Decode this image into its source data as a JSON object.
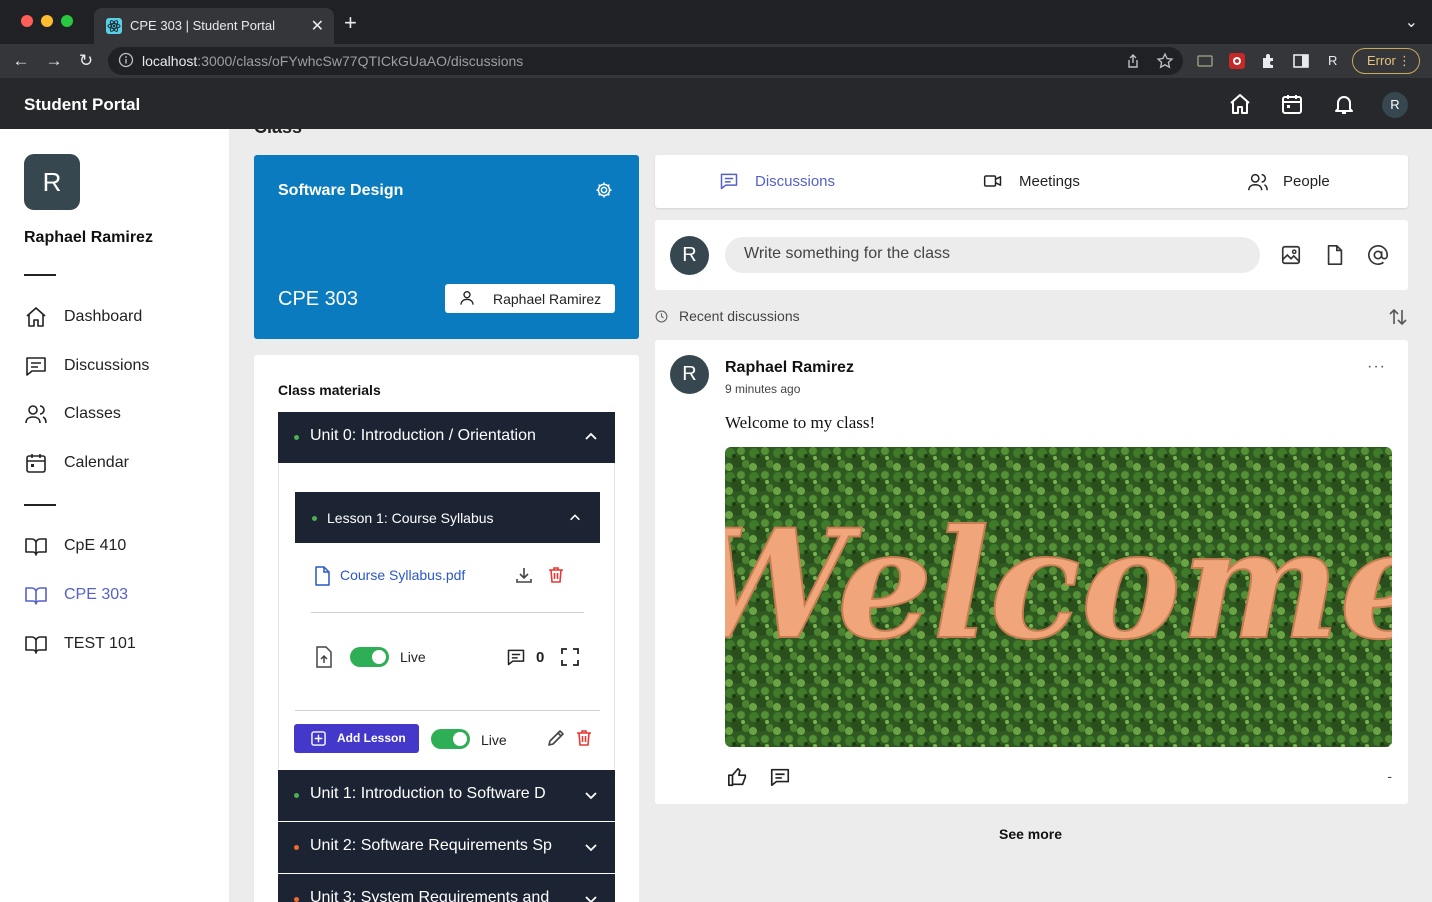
{
  "browser": {
    "tab_title": "CPE 303 | Student Portal",
    "url_host": "localhost",
    "url_path": ":3000/class/oFYwhcSw77QTICkGUaAO/discussions",
    "profile_initial": "R",
    "error_label": "Error"
  },
  "header": {
    "brand": "Student Portal",
    "avatar_initial": "R"
  },
  "sidebar": {
    "avatar_initial": "R",
    "user_name": "Raphael Ramirez",
    "nav": [
      {
        "label": "Dashboard",
        "icon": "home-icon"
      },
      {
        "label": "Discussions",
        "icon": "chat-icon"
      },
      {
        "label": "Classes",
        "icon": "people-icon"
      },
      {
        "label": "Calendar",
        "icon": "calendar-icon"
      }
    ],
    "classes": [
      {
        "label": "CpE 410",
        "active": false
      },
      {
        "label": "CPE 303",
        "active": true
      },
      {
        "label": "TEST 101",
        "active": false
      }
    ]
  },
  "class": {
    "section_title": "Class",
    "name": "Software Design",
    "code": "CPE 303",
    "teacher": "Raphael Ramirez"
  },
  "materials": {
    "title": "Class materials",
    "units": [
      {
        "label": "Unit 0: Introduction / Orientation",
        "status_color": "#4caf50",
        "expanded": true
      },
      {
        "label": "Unit 1: Introduction to Software D",
        "status_color": "#4caf50",
        "expanded": false
      },
      {
        "label": "Unit 2: Software Requirements Sp",
        "status_color": "#f26b2f",
        "expanded": false
      },
      {
        "label": "Unit 3: System Requirements and",
        "status_color": "#f26b2f",
        "expanded": false
      }
    ],
    "lesson": {
      "label": "Lesson 1: Course Syllabus",
      "file": "Course Syllabus.pdf",
      "live_label": "Live",
      "comment_count": "0"
    },
    "add_lesson_label": "Add Lesson",
    "unit_live_label": "Live"
  },
  "tabs": [
    {
      "label": "Discussions",
      "active": true
    },
    {
      "label": "Meetings",
      "active": false
    },
    {
      "label": "People",
      "active": false
    }
  ],
  "composer": {
    "avatar_initial": "R",
    "placeholder": "Write something for the class"
  },
  "feed": {
    "recent_label": "Recent discussions",
    "post": {
      "avatar_initial": "R",
      "author": "Raphael Ramirez",
      "time": "9 minutes ago",
      "menu": "···",
      "body": "Welcome to my class!",
      "image_text": "Welcome",
      "reactions": "-"
    },
    "see_more": "See more"
  },
  "colors": {
    "accent": "#5561c9",
    "class_card": "#0a7bbf",
    "dark_row": "#1c2433",
    "toggle_on": "#2eae55",
    "add_lesson": "#4338ca",
    "delete": "#e53935"
  }
}
